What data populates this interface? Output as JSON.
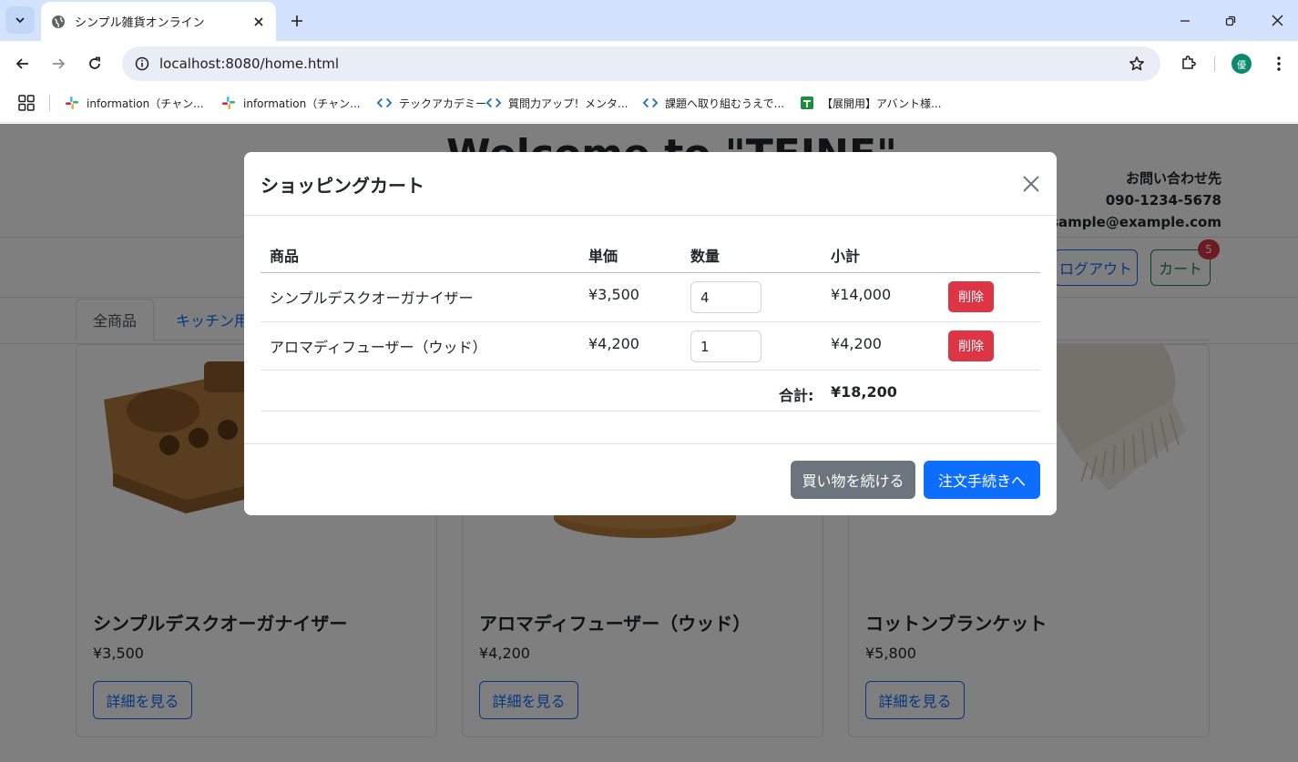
{
  "browser": {
    "tab_title": "シンプル雑貨オンライン",
    "url": "localhost:8080/home.html",
    "profile_initial": "優",
    "bookmarks": [
      "information（チャン...",
      "information（チャン...",
      "テックアカデミー",
      "質問力アップ！メンタ...",
      "課題へ取り組むうえで...",
      "【展開用】アバント様..."
    ]
  },
  "site": {
    "title": "Welcome to \"TEINE\"",
    "contact_heading": "お問い合わせ先",
    "contact_phone": "090-1234-5678",
    "contact_email": "sample@example.com",
    "logout_label": "ログアウト",
    "cart_label": "カート",
    "cart_count": "5",
    "tabs": [
      "全商品",
      "キッチン用品"
    ]
  },
  "products": [
    {
      "name": "シンプルデスクオーガナイザー",
      "price": "¥3,500",
      "button": "詳細を見る"
    },
    {
      "name": "アロマディフューザー（ウッド）",
      "price": "¥4,200",
      "button": "詳細を見る"
    },
    {
      "name": "コットンブランケット",
      "price": "¥5,800",
      "button": "詳細を見る"
    }
  ],
  "cart_modal": {
    "title": "ショッピングカート",
    "headers": {
      "item": "商品",
      "unit_price": "単価",
      "quantity": "数量",
      "subtotal": "小計"
    },
    "rows": [
      {
        "name": "シンプルデスクオーガナイザー",
        "unit_price": "¥3,500",
        "quantity": "4",
        "subtotal": "¥14,000",
        "delete": "削除"
      },
      {
        "name": "アロマディフューザー（ウッド）",
        "unit_price": "¥4,200",
        "quantity": "1",
        "subtotal": "¥4,200",
        "delete": "削除"
      }
    ],
    "total_label": "合計:",
    "total_value": "¥18,200",
    "continue_label": "買い物を続ける",
    "checkout_label": "注文手続きへ"
  },
  "colors": {
    "primary": "#0d6efd",
    "danger": "#dc3545",
    "secondary": "#6c757d",
    "success": "#198754"
  }
}
